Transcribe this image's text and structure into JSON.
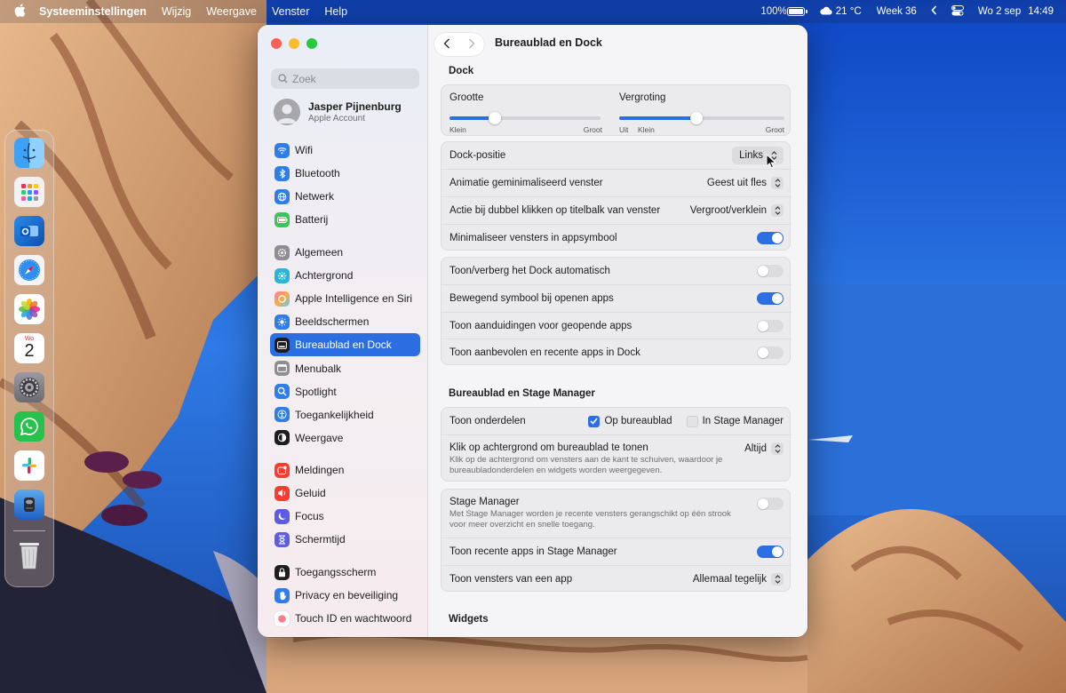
{
  "menubar": {
    "app_name": "Systeeminstellingen",
    "items": [
      "Wijzig",
      "Weergave",
      "Venster",
      "Help"
    ],
    "battery_percent": "100%",
    "weather": "21 °C",
    "week": "Week 36",
    "datetime_date": "Wo 2 sep",
    "datetime_time": "14:49"
  },
  "dock": {
    "apps": [
      "Finder",
      "Launchpad",
      "Outlook",
      "Safari",
      "Foto's",
      "Agenda",
      "Systeeminstellingen",
      "WhatsApp",
      "Slack",
      "Schijfhulpprogramma"
    ],
    "calendar_month": "Wo",
    "calendar_day": "2",
    "trash": "Prullenmand"
  },
  "sidebar": {
    "search_placeholder": "Zoek",
    "account_name": "Jasper Pijnenburg",
    "account_sub": "Apple Account",
    "group1": [
      "Wifi",
      "Bluetooth",
      "Netwerk",
      "Batterij"
    ],
    "group2": [
      "Algemeen",
      "Achtergrond",
      "Apple Intelligence en Siri",
      "Beeldschermen",
      "Bureaublad en Dock",
      "Menubalk",
      "Spotlight",
      "Toegankelijkheid",
      "Weergave"
    ],
    "group3": [
      "Meldingen",
      "Geluid",
      "Focus",
      "Schermtijd"
    ],
    "group4": [
      "Toegangsscherm",
      "Privacy en beveiliging",
      "Touch ID en wachtwoord"
    ],
    "active": "Bureaublad en Dock"
  },
  "main": {
    "title": "Bureaublad en Dock",
    "dock_section": "Dock",
    "size_label": "Grootte",
    "size_min": "Klein",
    "size_max": "Groot",
    "size_value": 0.3,
    "magnify_label": "Vergroting",
    "magnify_off": "Uit",
    "magnify_min": "Klein",
    "magnify_max": "Groot",
    "magnify_value": 0.47,
    "dock_position_label": "Dock-positie",
    "dock_position_value": "Links",
    "minimize_anim_label": "Animatie geminimaliseerd venster",
    "minimize_anim_value": "Geest uit fles",
    "double_click_label": "Actie bij dubbel klikken op titelbalk van venster",
    "double_click_value": "Vergroot/verklein",
    "minimize_into_app_label": "Minimaliseer vensters in appsymbool",
    "minimize_into_app_on": true,
    "autohide_label": "Toon/verberg het Dock automatisch",
    "autohide_on": false,
    "animate_label": "Bewegend symbool bij openen apps",
    "animate_on": true,
    "indicators_label": "Toon aanduidingen voor geopende apps",
    "indicators_on": false,
    "recent_label": "Toon aanbevolen en recente apps in Dock",
    "recent_on": false,
    "stage_section": "Bureaublad en Stage Manager",
    "show_items_label": "Toon onderdelen",
    "on_desktop_label": "Op bureaublad",
    "on_desktop_checked": true,
    "in_stage_label": "In Stage Manager",
    "in_stage_checked": false,
    "click_wallpaper_label": "Klik op achtergrond om bureaublad te tonen",
    "click_wallpaper_desc": "Klik op de achtergrond om vensters aan de kant te schuiven, waardoor je bureaubladonderdelen en widgets worden weergegeven.",
    "click_wallpaper_value": "Altijd",
    "stage_manager_label": "Stage Manager",
    "stage_manager_desc": "Met Stage Manager worden je recente vensters gerangschikt op één strook voor meer overzicht en snelle toegang.",
    "stage_manager_on": false,
    "recent_stage_label": "Toon recente apps in Stage Manager",
    "recent_stage_on": true,
    "windows_from_app_label": "Toon vensters van een app",
    "windows_from_app_value": "Allemaal tegelijk",
    "widgets_section": "Widgets"
  },
  "colors": {
    "accent": "#2c6fe3",
    "sidebar_active": "#2a6ee2"
  }
}
